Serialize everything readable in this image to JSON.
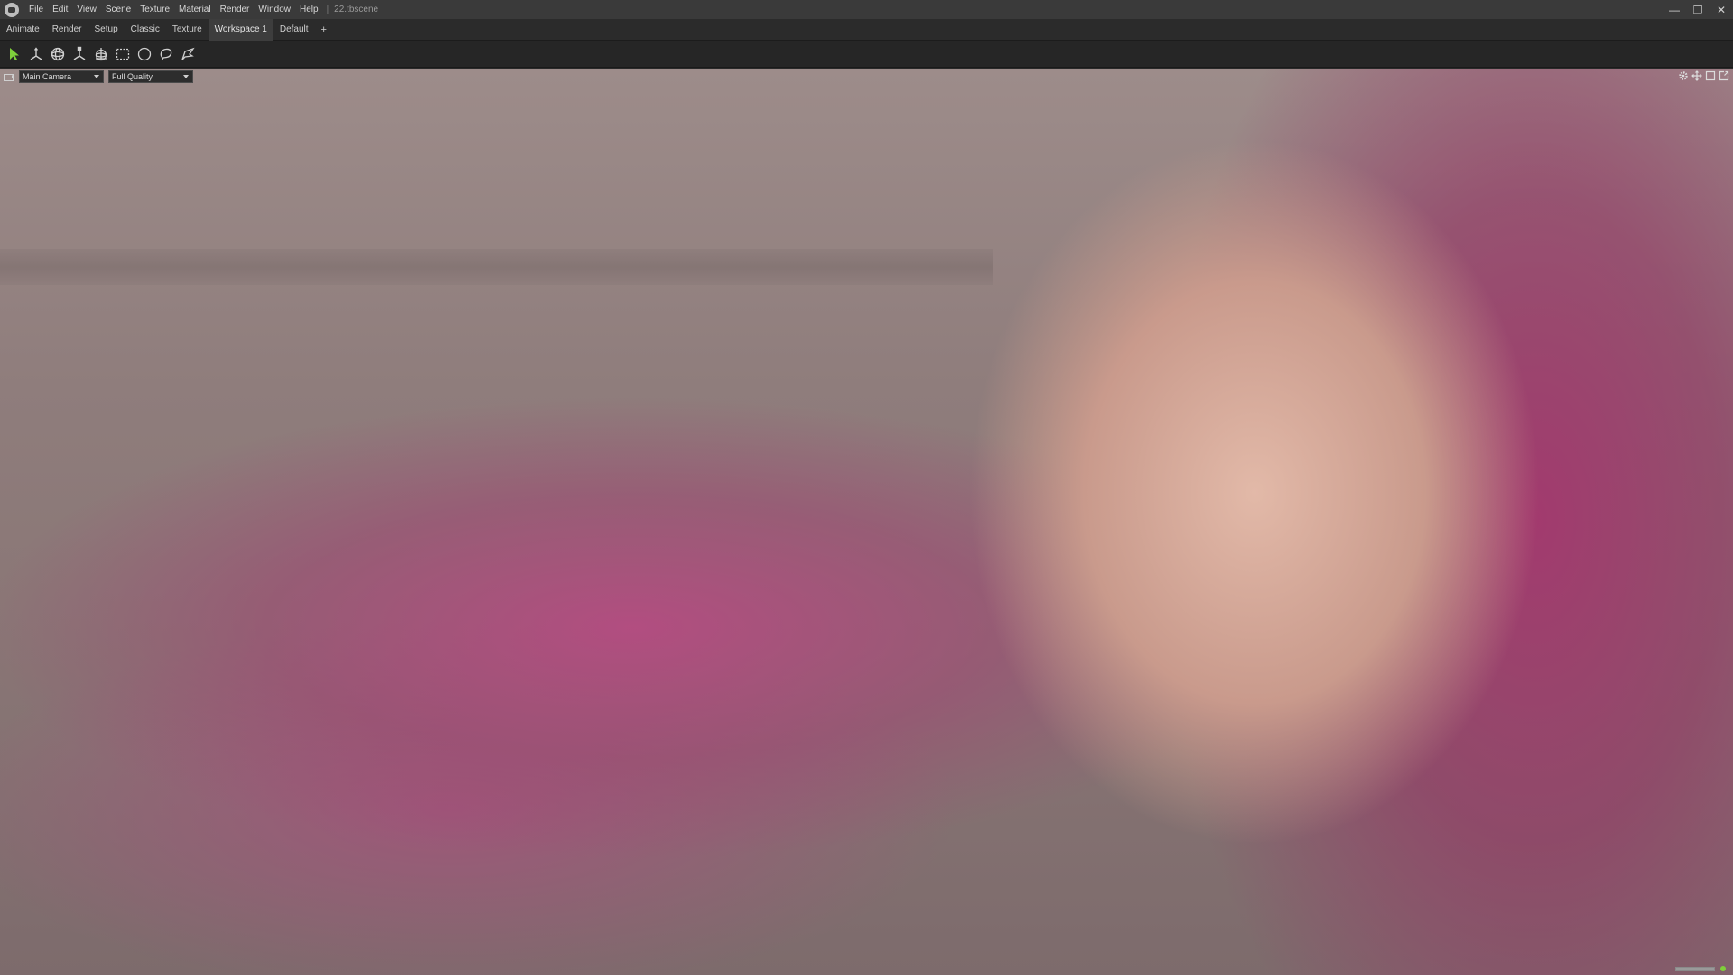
{
  "titlebar": {
    "menu": [
      "File",
      "Edit",
      "View",
      "Scene",
      "Texture",
      "Material",
      "Render",
      "Window",
      "Help"
    ],
    "separator": "|",
    "scene_name": "22.tbscene"
  },
  "window_controls": {
    "minimize": "—",
    "maximize": "❐",
    "close": "✕"
  },
  "workspace_tabs": {
    "tabs": [
      "Animate",
      "Render",
      "Setup",
      "Classic",
      "Texture",
      "Workspace 1",
      "Default"
    ],
    "active": "Workspace 1",
    "add_label": "+"
  },
  "tools": [
    {
      "name": "select-tool-icon",
      "color": "#7fd13b"
    },
    {
      "name": "move-tool-icon",
      "color": "#d0d0d0"
    },
    {
      "name": "rotate-tool-icon",
      "color": "#d0d0d0"
    },
    {
      "name": "scale-tool-icon",
      "color": "#d0d0d0"
    },
    {
      "name": "transform-tool-icon",
      "color": "#d0d0d0"
    },
    {
      "name": "rect-select-icon",
      "color": "#d0d0d0"
    },
    {
      "name": "circle-select-icon",
      "color": "#d0d0d0"
    },
    {
      "name": "lasso-select-icon",
      "color": "#d0d0d0"
    },
    {
      "name": "paint-select-icon",
      "color": "#d0d0d0"
    }
  ],
  "viewport": {
    "camera": "Main Camera",
    "quality": "Full Quality",
    "right_icons": [
      "gear-icon",
      "move-view-icon",
      "maximize-viewport-icon",
      "popout-icon"
    ],
    "render_progress": 1.0,
    "status_color": "#7fcf3a"
  }
}
